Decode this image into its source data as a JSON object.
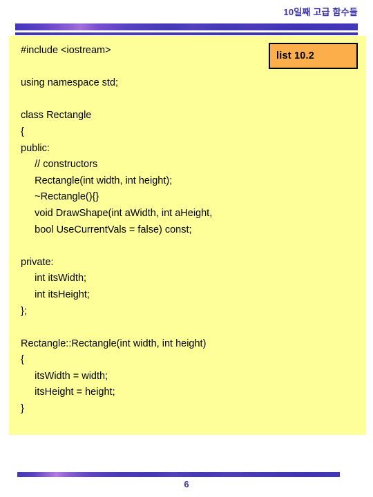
{
  "slide": {
    "title": "10일째 고급 함수들",
    "page_number": "6",
    "accent_color": "#3A32A8",
    "bar_gradient_light": "#b47ce2",
    "panel_color": "#ffff99",
    "badge_color": "#FBAE49"
  },
  "badge": {
    "label": "list 10.2"
  },
  "code": {
    "language": "cpp",
    "lines": [
      "#include <iostream>",
      "",
      "using namespace std;",
      "",
      "class Rectangle",
      "{",
      "public:",
      "     // constructors",
      "     Rectangle(int width, int height);",
      "     ~Rectangle(){}",
      "     void DrawShape(int aWidth, int aHeight,",
      "     bool UseCurrentVals = false) const;",
      "",
      "private:",
      "     int itsWidth;",
      "     int itsHeight;",
      "};",
      "",
      "Rectangle::Rectangle(int width, int height)",
      "{",
      "     itsWidth = width;",
      "     itsHeight = height;",
      "}"
    ]
  }
}
